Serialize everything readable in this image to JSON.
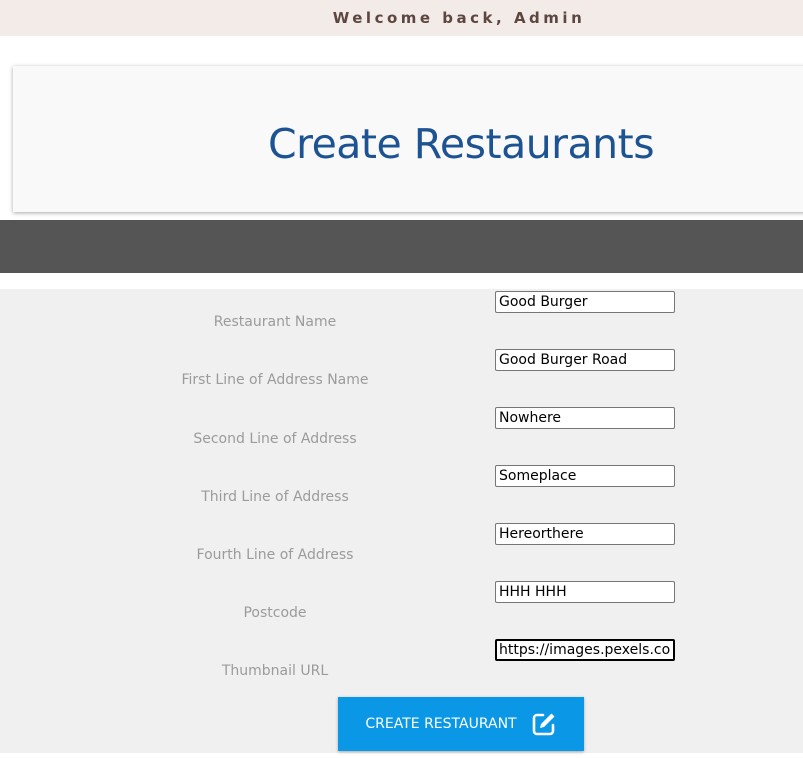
{
  "header": {
    "welcome": "Welcome back, Admin"
  },
  "page": {
    "title": "Create Restaurants"
  },
  "form": {
    "fields": [
      {
        "label": "Restaurant Name",
        "value": "Good Burger"
      },
      {
        "label": "First Line of Address Name",
        "value": "Good Burger Road"
      },
      {
        "label": "Second Line of Address",
        "value": "Nowhere"
      },
      {
        "label": "Third Line of Address",
        "value": "Someplace"
      },
      {
        "label": "Fourth Line of Address",
        "value": "Hereorthere"
      },
      {
        "label": "Postcode",
        "value": "HHH HHH"
      },
      {
        "label": "Thumbnail URL",
        "value": "https://images.pexels.com"
      }
    ],
    "submit_label": "CREATE RESTAURANT",
    "submit_icon": "edit-icon"
  },
  "colors": {
    "title": "#1d5392",
    "button": "#0a97e6",
    "welcome_bar": "#f2ebe8",
    "dark_band": "#555555"
  }
}
